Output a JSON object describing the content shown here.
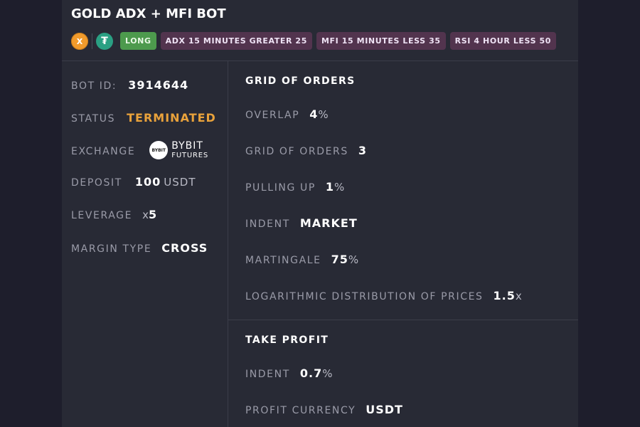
{
  "bot": {
    "title": "GOLD ADX + MFI BOT",
    "coins": [
      {
        "icon": "x-coin-icon",
        "glyph": "X",
        "color": "#f19b2c"
      },
      {
        "icon": "tether-icon",
        "glyph": "₮",
        "color": "#2aa083"
      }
    ],
    "tags": [
      "LONG",
      "ADX 15 MINUTES GREATER 25",
      "MFI 15 MINUTES LESS 35",
      "RSI 4 HOUR LESS 50"
    ]
  },
  "info": {
    "bot_id_label": "BOT ID:",
    "bot_id": "3914644",
    "status_label": "STATUS",
    "status": "TERMINATED",
    "status_color": "#e9a23b",
    "exchange_label": "EXCHANGE",
    "exchange_logo_text": "BYBIT",
    "exchange_name": "BYBIT",
    "exchange_sub": "FUTURES",
    "deposit_label": "DEPOSIT",
    "deposit_value": "100",
    "deposit_unit": "USDT",
    "leverage_label": "LEVERAGE",
    "leverage_prefix": "x",
    "leverage_value": "5",
    "margin_type_label": "MARGIN TYPE",
    "margin_type": "CROSS"
  },
  "grid": {
    "title": "GRID OF ORDERS",
    "overlap_label": "OVERLAP",
    "overlap_value": "4",
    "overlap_unit": "%",
    "grid_orders_label": "GRID OF ORDERS",
    "grid_orders_value": "3",
    "pulling_up_label": "PULLING UP",
    "pulling_up_value": "1",
    "pulling_up_unit": "%",
    "indent_label": "INDENT",
    "indent_value": "MARKET",
    "martingale_label": "MARTINGALE",
    "martingale_value": "75",
    "martingale_unit": "%",
    "log_label": "LOGARITHMIC DISTRIBUTION OF PRICES",
    "log_value": "1.5",
    "log_unit": "x"
  },
  "take_profit": {
    "title": "TAKE PROFIT",
    "indent_label": "INDENT",
    "indent_value": "0.7",
    "indent_unit": "%",
    "currency_label": "PROFIT CURRENCY",
    "currency_value": "USDT"
  }
}
